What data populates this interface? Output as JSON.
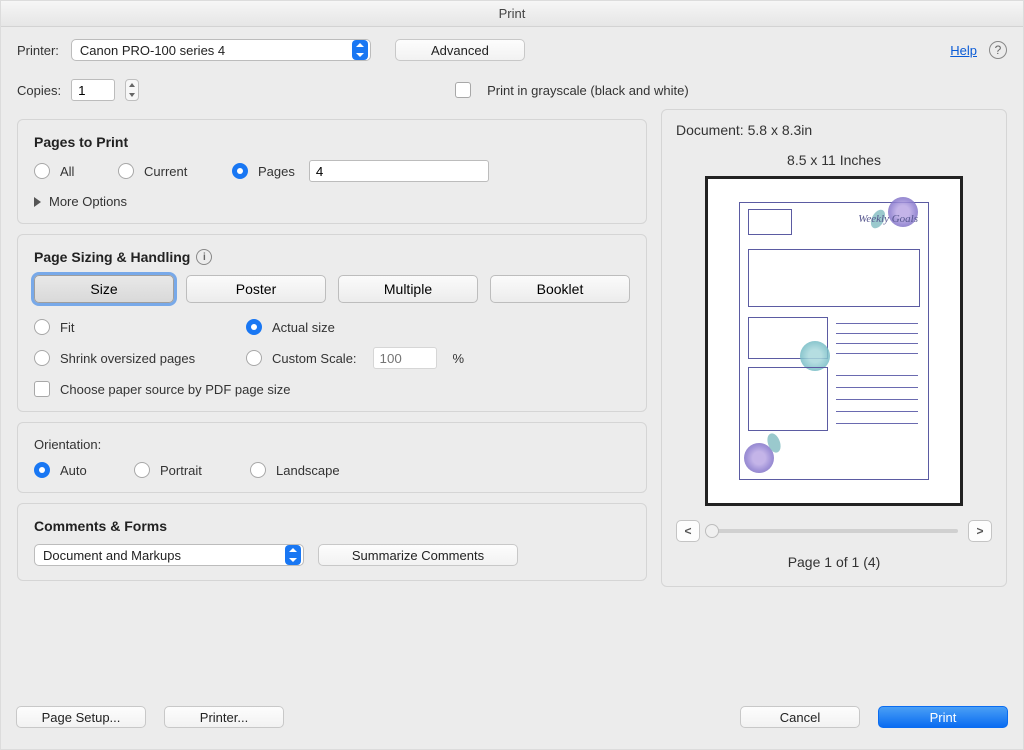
{
  "window": {
    "title": "Print"
  },
  "header": {
    "printer_label": "Printer:",
    "printer_value": "Canon PRO-100 series 4",
    "advanced_label": "Advanced",
    "help_label": "Help",
    "copies_label": "Copies:",
    "copies_value": "1",
    "grayscale_label": "Print in grayscale (black and white)"
  },
  "pages": {
    "title": "Pages to Print",
    "all": "All",
    "current": "Current",
    "pages": "Pages",
    "range_value": "4",
    "more": "More Options"
  },
  "sizing": {
    "title": "Page Sizing & Handling",
    "tabs": {
      "size": "Size",
      "poster": "Poster",
      "multiple": "Multiple",
      "booklet": "Booklet"
    },
    "fit": "Fit",
    "actual": "Actual size",
    "shrink": "Shrink oversized pages",
    "custom": "Custom Scale:",
    "custom_value": "100",
    "percent": "%",
    "paper_source": "Choose paper source by PDF page size"
  },
  "orientation": {
    "title": "Orientation:",
    "auto": "Auto",
    "portrait": "Portrait",
    "landscape": "Landscape"
  },
  "comments": {
    "title": "Comments & Forms",
    "select_value": "Document and Markups",
    "summarize": "Summarize Comments"
  },
  "preview": {
    "doc_size": "Document: 5.8 x 8.3in",
    "paper_size": "8.5 x 11 Inches",
    "doc_title_a": "Weekly",
    "doc_title_b": "Goals",
    "page_status": "Page 1 of 1 (4)",
    "prev": "<",
    "next": ">"
  },
  "footer": {
    "page_setup": "Page Setup...",
    "printer": "Printer...",
    "cancel": "Cancel",
    "print": "Print"
  }
}
